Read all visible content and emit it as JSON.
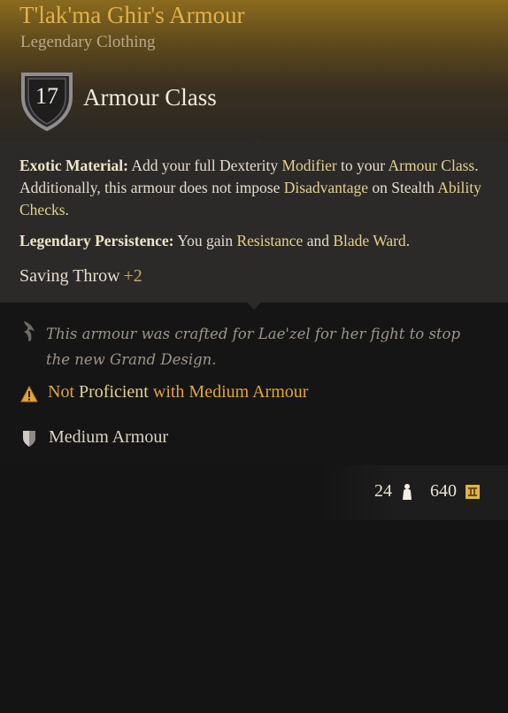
{
  "item": {
    "name": "T'lak'ma Ghir's Armour",
    "rarity_type": "Legendary Clothing",
    "armour_class_value": "17",
    "armour_class_label": "Armour Class"
  },
  "description": {
    "exotic": {
      "name": "Exotic Material:",
      "t1": " Add your full Dexterity ",
      "k1": "Modifier",
      "t2": " to your ",
      "k2": "Armour Class",
      "t3": ". Additionally, this armour does not impose ",
      "k3": "Disadvantage",
      "t4": " on Stealth ",
      "k4": "Ability Checks",
      "t5": "."
    },
    "legendary": {
      "name": "Legendary Persistence:",
      "t1": " You gain ",
      "k1": "Resistance",
      "t2": " and ",
      "k2": "Blade Ward",
      "t3": "."
    },
    "saving_throw_label": "Saving Throw",
    "saving_throw_bonus": "+2"
  },
  "flavor_text": "This armour was crafted for Lae'zel for her fight to stop the new Grand Design.",
  "proficiency_warning": {
    "not": "Not",
    "proficient": " Proficient ",
    "category": "with Medium Armour"
  },
  "armour_type": "Medium Armour",
  "footer": {
    "weight": "24",
    "price": "640"
  },
  "icons": {
    "armour_class": "shield-icon",
    "flavor": "quill-icon",
    "warning": "warning-icon",
    "armour_type": "medium-armour-shield-icon",
    "weight": "weight-icon",
    "gold": "gold-coin-icon"
  },
  "colors": {
    "title": "#e3b14a",
    "keyword": "#e7d08a",
    "warning": "#e3a43c",
    "header_gold": "#8a6a1e"
  }
}
